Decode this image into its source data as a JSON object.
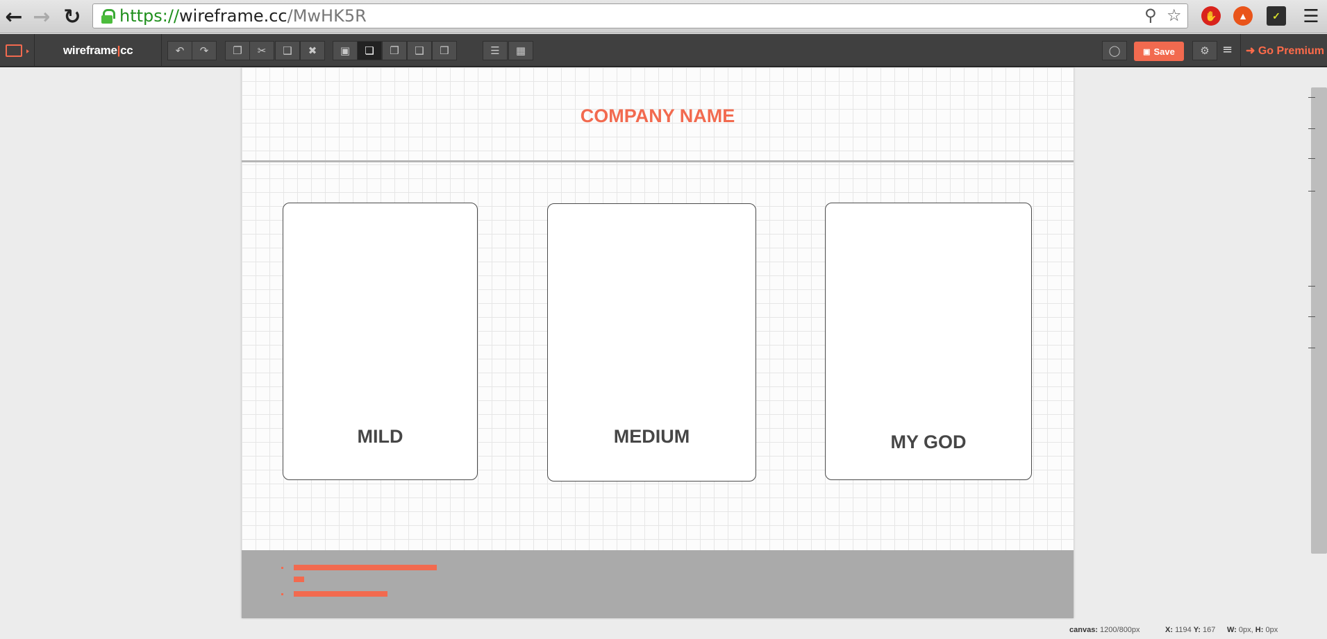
{
  "browser": {
    "url_scheme": "https://",
    "url_host": "wireframe.cc",
    "url_path": "/MwHK5R"
  },
  "app": {
    "logo_main": "wireframe",
    "logo_sep": "|",
    "logo_suffix": "cc",
    "save_label": "Save",
    "premium_label": "Go Premium"
  },
  "canvas": {
    "company_name": "COMPANY NAME",
    "cards": [
      {
        "label": "MILD"
      },
      {
        "label": "MEDIUM"
      },
      {
        "label": "MY GOD"
      }
    ]
  },
  "status": {
    "canvas_label": "canvas:",
    "canvas_value": "1200/800px",
    "x_label": "X:",
    "x_value": "1194",
    "y_label": "Y:",
    "y_value": "167",
    "w_label": "W:",
    "w_value": "0px,",
    "h_label": "H:",
    "h_value": "0px"
  },
  "colors": {
    "accent": "#f26a4f",
    "toolbar": "#404040"
  }
}
